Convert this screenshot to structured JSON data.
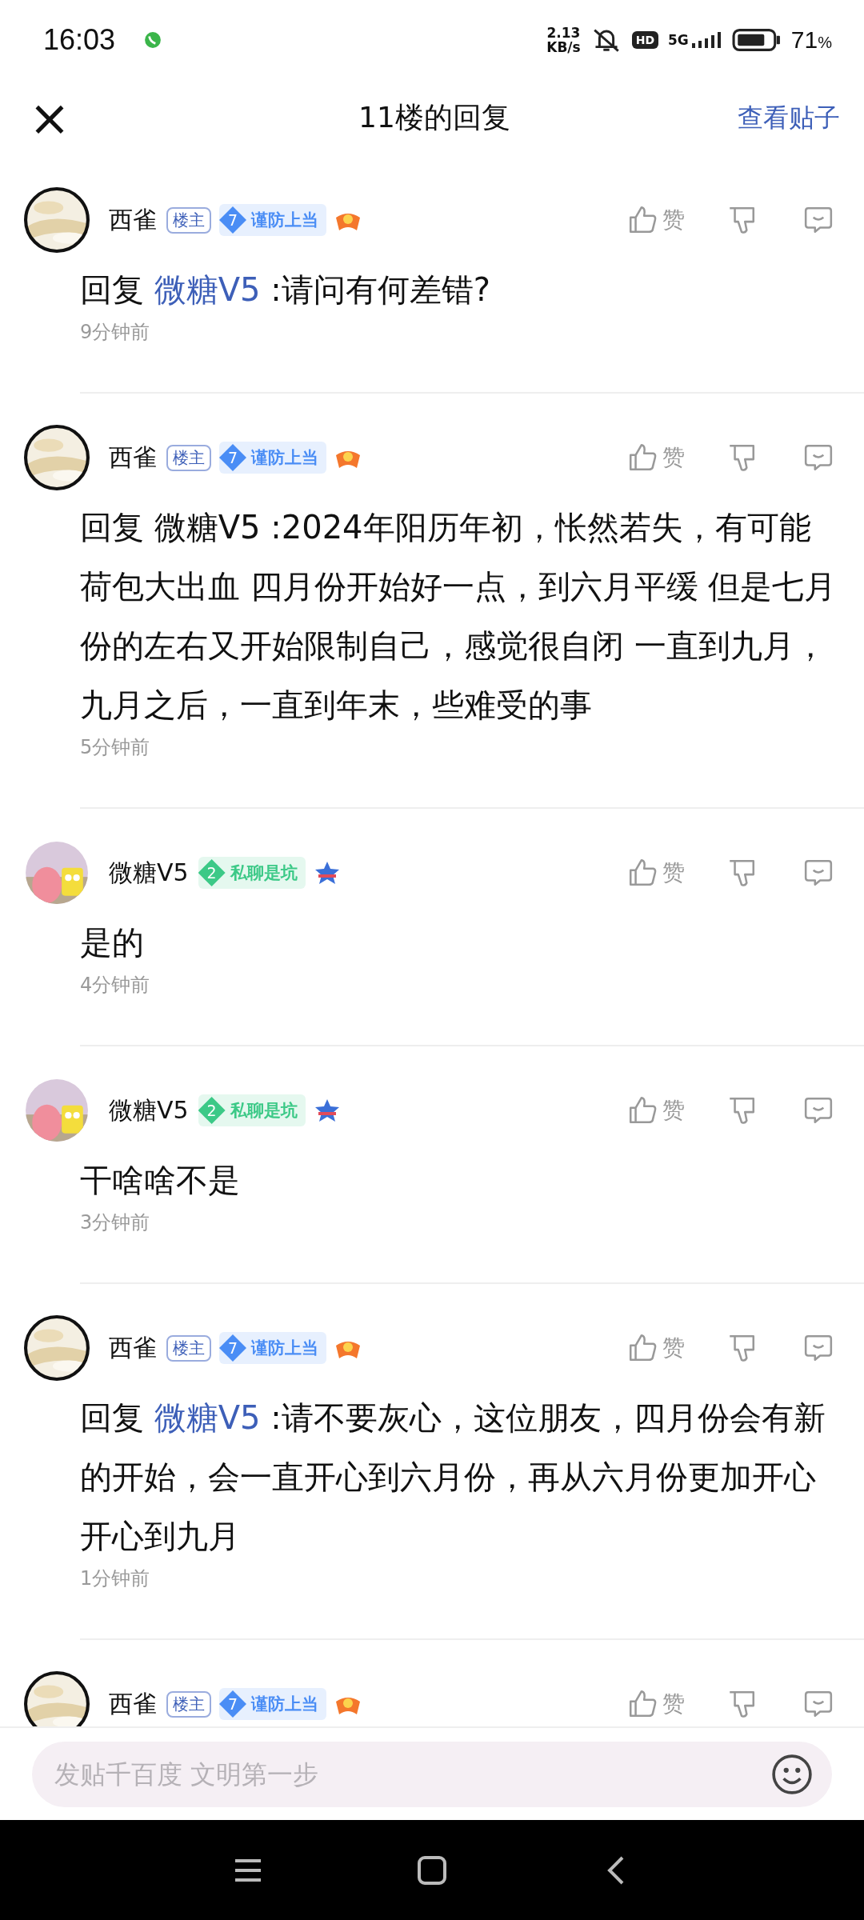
{
  "status_bar": {
    "time": "16:03",
    "speed_value": "2.13",
    "speed_unit": "KB/s",
    "hd": "HD",
    "network": "5G",
    "battery": "71",
    "battery_unit": "%"
  },
  "header": {
    "close": "×",
    "title": "11楼的回复",
    "action": "查看贴子"
  },
  "comments": [
    {
      "kind": "owner",
      "name": "西雀",
      "owner_tag": "楼主",
      "level_badge": {
        "number": "7",
        "title": "谨防上当",
        "color": "#4a8df5"
      },
      "reply_prefix": "回复",
      "reply_to": "微糖V5",
      "reply_link": true,
      "text": ":请问有何差错?",
      "time": "9分钟前",
      "like": "赞"
    },
    {
      "kind": "owner",
      "name": "西雀",
      "owner_tag": "楼主",
      "level_badge": {
        "number": "7",
        "title": "谨防上当",
        "color": "#4a8df5"
      },
      "reply_prefix": "回复",
      "reply_to": "微糖V5",
      "reply_link": false,
      "text": ":2024年阳历年初，怅然若失，有可能荷包大出血 四月份开始好一点，到六月平缓 但是七月份的左右又开始限制自己，感觉很自闭 一直到九月，九月之后，一直到年末，些难受的事",
      "time": "5分钟前",
      "like": "赞"
    },
    {
      "kind": "member",
      "name": "微糖V5",
      "level_badge": {
        "number": "2",
        "title": "私聊是坑",
        "color": "#3cc987"
      },
      "text": "是的",
      "time": "4分钟前",
      "like": "赞"
    },
    {
      "kind": "member",
      "name": "微糖V5",
      "level_badge": {
        "number": "2",
        "title": "私聊是坑",
        "color": "#3cc987"
      },
      "text": "干啥啥不是",
      "time": "3分钟前",
      "like": "赞"
    },
    {
      "kind": "owner",
      "name": "西雀",
      "owner_tag": "楼主",
      "level_badge": {
        "number": "7",
        "title": "谨防上当",
        "color": "#4a8df5"
      },
      "reply_prefix": "回复",
      "reply_to": "微糖V5",
      "reply_link": true,
      "text": ":请不要灰心，这位朋友，四月份会有新的开始，会一直开心到六月份，再从六月份更加开心开心到九月",
      "time": "1分钟前",
      "like": "赞"
    },
    {
      "kind": "owner",
      "name": "西雀",
      "owner_tag": "楼主",
      "level_badge": {
        "number": "7",
        "title": "谨防上当",
        "color": "#4a8df5"
      },
      "like": "赞"
    }
  ],
  "input": {
    "placeholder": "发贴千百度 文明第一步"
  }
}
